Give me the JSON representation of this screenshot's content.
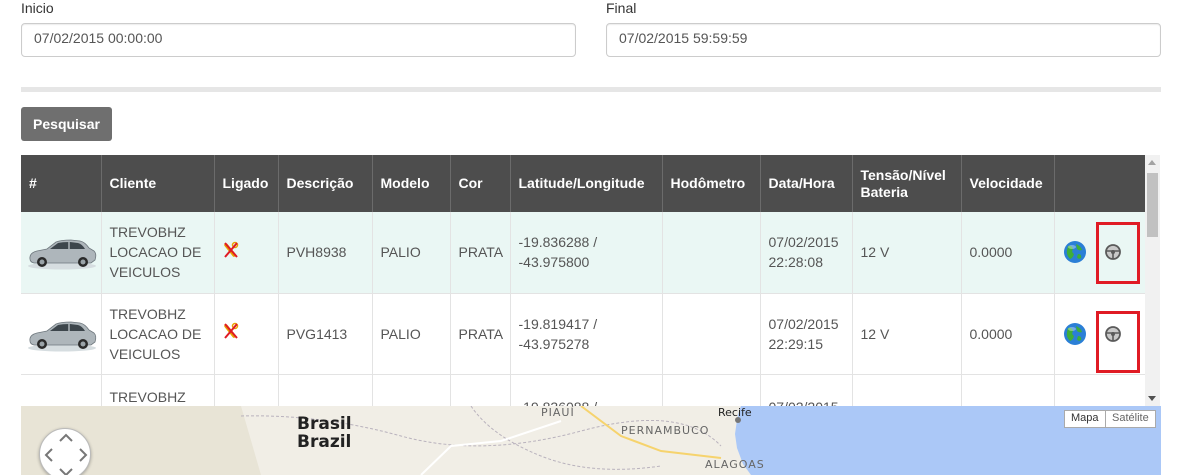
{
  "form": {
    "start_label": "Inicio",
    "start_value": "07/02/2015 00:00:00",
    "end_label": "Final",
    "end_value": "07/02/2015 59:59:59",
    "search_button": "Pesquisar"
  },
  "table": {
    "headers": [
      "#",
      "Cliente",
      "Ligado",
      "Descrição",
      "Modelo",
      "Cor",
      "Latitude/Longitude",
      "Hodômetro",
      "Data/Hora",
      "Tensão/Nível Bateria",
      "Velocidade",
      ""
    ],
    "rows": [
      {
        "cliente": "TREVOBHZ LOCACAO DE VEICULOS",
        "descricao": "PVH8938",
        "modelo": "PALIO",
        "cor": "PRATA",
        "latlng": "-19.836288 / -43.975800",
        "hodometro": "",
        "datahora": "07/02/2015 22:28:08",
        "tensao": "12 V",
        "velocidade": "0.0000"
      },
      {
        "cliente": "TREVOBHZ LOCACAO DE VEICULOS",
        "descricao": "PVG1413",
        "modelo": "PALIO",
        "cor": "PRATA",
        "latlng": "-19.819417 / -43.975278",
        "hodometro": "",
        "datahora": "07/02/2015 22:29:15",
        "tensao": "12 V",
        "velocidade": "0.0000"
      },
      {
        "cliente": "TREVOBHZ",
        "descricao": "",
        "modelo": "",
        "cor": "",
        "latlng": "-19.836088 /",
        "hodometro": "",
        "datahora": "07/02/2015",
        "tensao": "",
        "velocidade": ""
      }
    ]
  },
  "map": {
    "labels": {
      "brasil": "Brasil",
      "brazil": "Brazil",
      "piaui": "PIAUÍ",
      "pernambuco": "PERNAMBUCO",
      "recife": "Recife",
      "alagoas": "ALAGOAS"
    },
    "map_button": "Mapa",
    "satellite_button": "Satélite"
  },
  "colors": {
    "header_bg": "#4d4d4d",
    "row_highlight": "#eaf7f4",
    "button_bg": "#6f6f6f",
    "annotation_red": "#e01b24",
    "ocean": "#abc8f7"
  }
}
